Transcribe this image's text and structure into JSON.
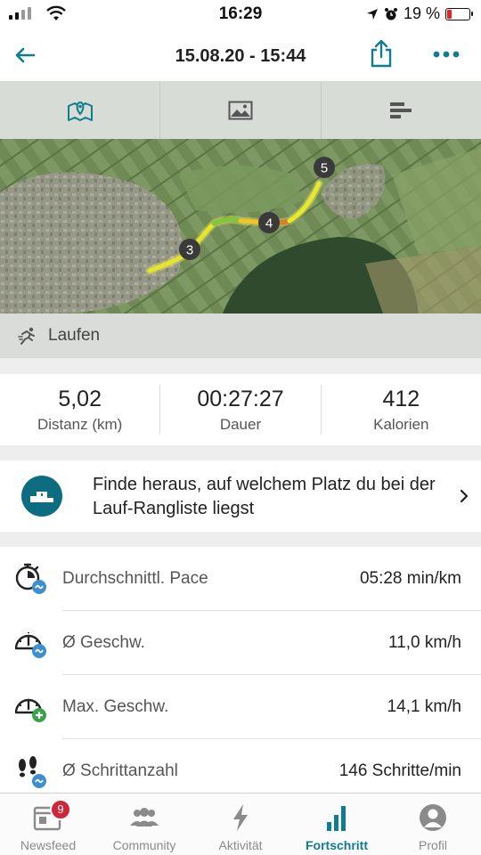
{
  "status_bar": {
    "time": "16:29",
    "battery": "19 %",
    "battery_level": 0.19
  },
  "header": {
    "title": "15.08.20 - 15:44"
  },
  "tabs": [
    {
      "name": "map",
      "icon": "map-icon"
    },
    {
      "name": "photos",
      "icon": "image-icon"
    },
    {
      "name": "charts",
      "icon": "bar-chart-icon"
    }
  ],
  "map": {
    "markers": [
      "3",
      "4",
      "5"
    ]
  },
  "activity": {
    "label": "Laufen"
  },
  "stats": [
    {
      "value": "5,02",
      "caption": "Distanz (km)"
    },
    {
      "value": "00:27:27",
      "caption": "Dauer"
    },
    {
      "value": "412",
      "caption": "Kalorien"
    }
  ],
  "leaderboard": {
    "text": "Finde heraus, auf welchem Platz du bei der Lauf-Rangliste liegst"
  },
  "metrics": [
    {
      "label": "Durchschnittl. Pace",
      "value": "05:28 min/km",
      "icon": "stopwatch-icon"
    },
    {
      "label": "Ø Geschw.",
      "value": "11,0 km/h",
      "icon": "speedometer-icon"
    },
    {
      "label": "Max. Geschw.",
      "value": "14,1 km/h",
      "icon": "speedometer-plus-icon"
    },
    {
      "label": "Ø Schrittanzahl",
      "value": "146 Schritte/min",
      "icon": "footsteps-icon"
    }
  ],
  "nav": {
    "items": [
      {
        "label": "Newsfeed",
        "badge": "9"
      },
      {
        "label": "Community"
      },
      {
        "label": "Aktivität"
      },
      {
        "label": "Fortschritt",
        "active": true
      },
      {
        "label": "Profil"
      }
    ]
  },
  "colors": {
    "accent": "#0d7d8f",
    "badge": "#d0263a"
  }
}
